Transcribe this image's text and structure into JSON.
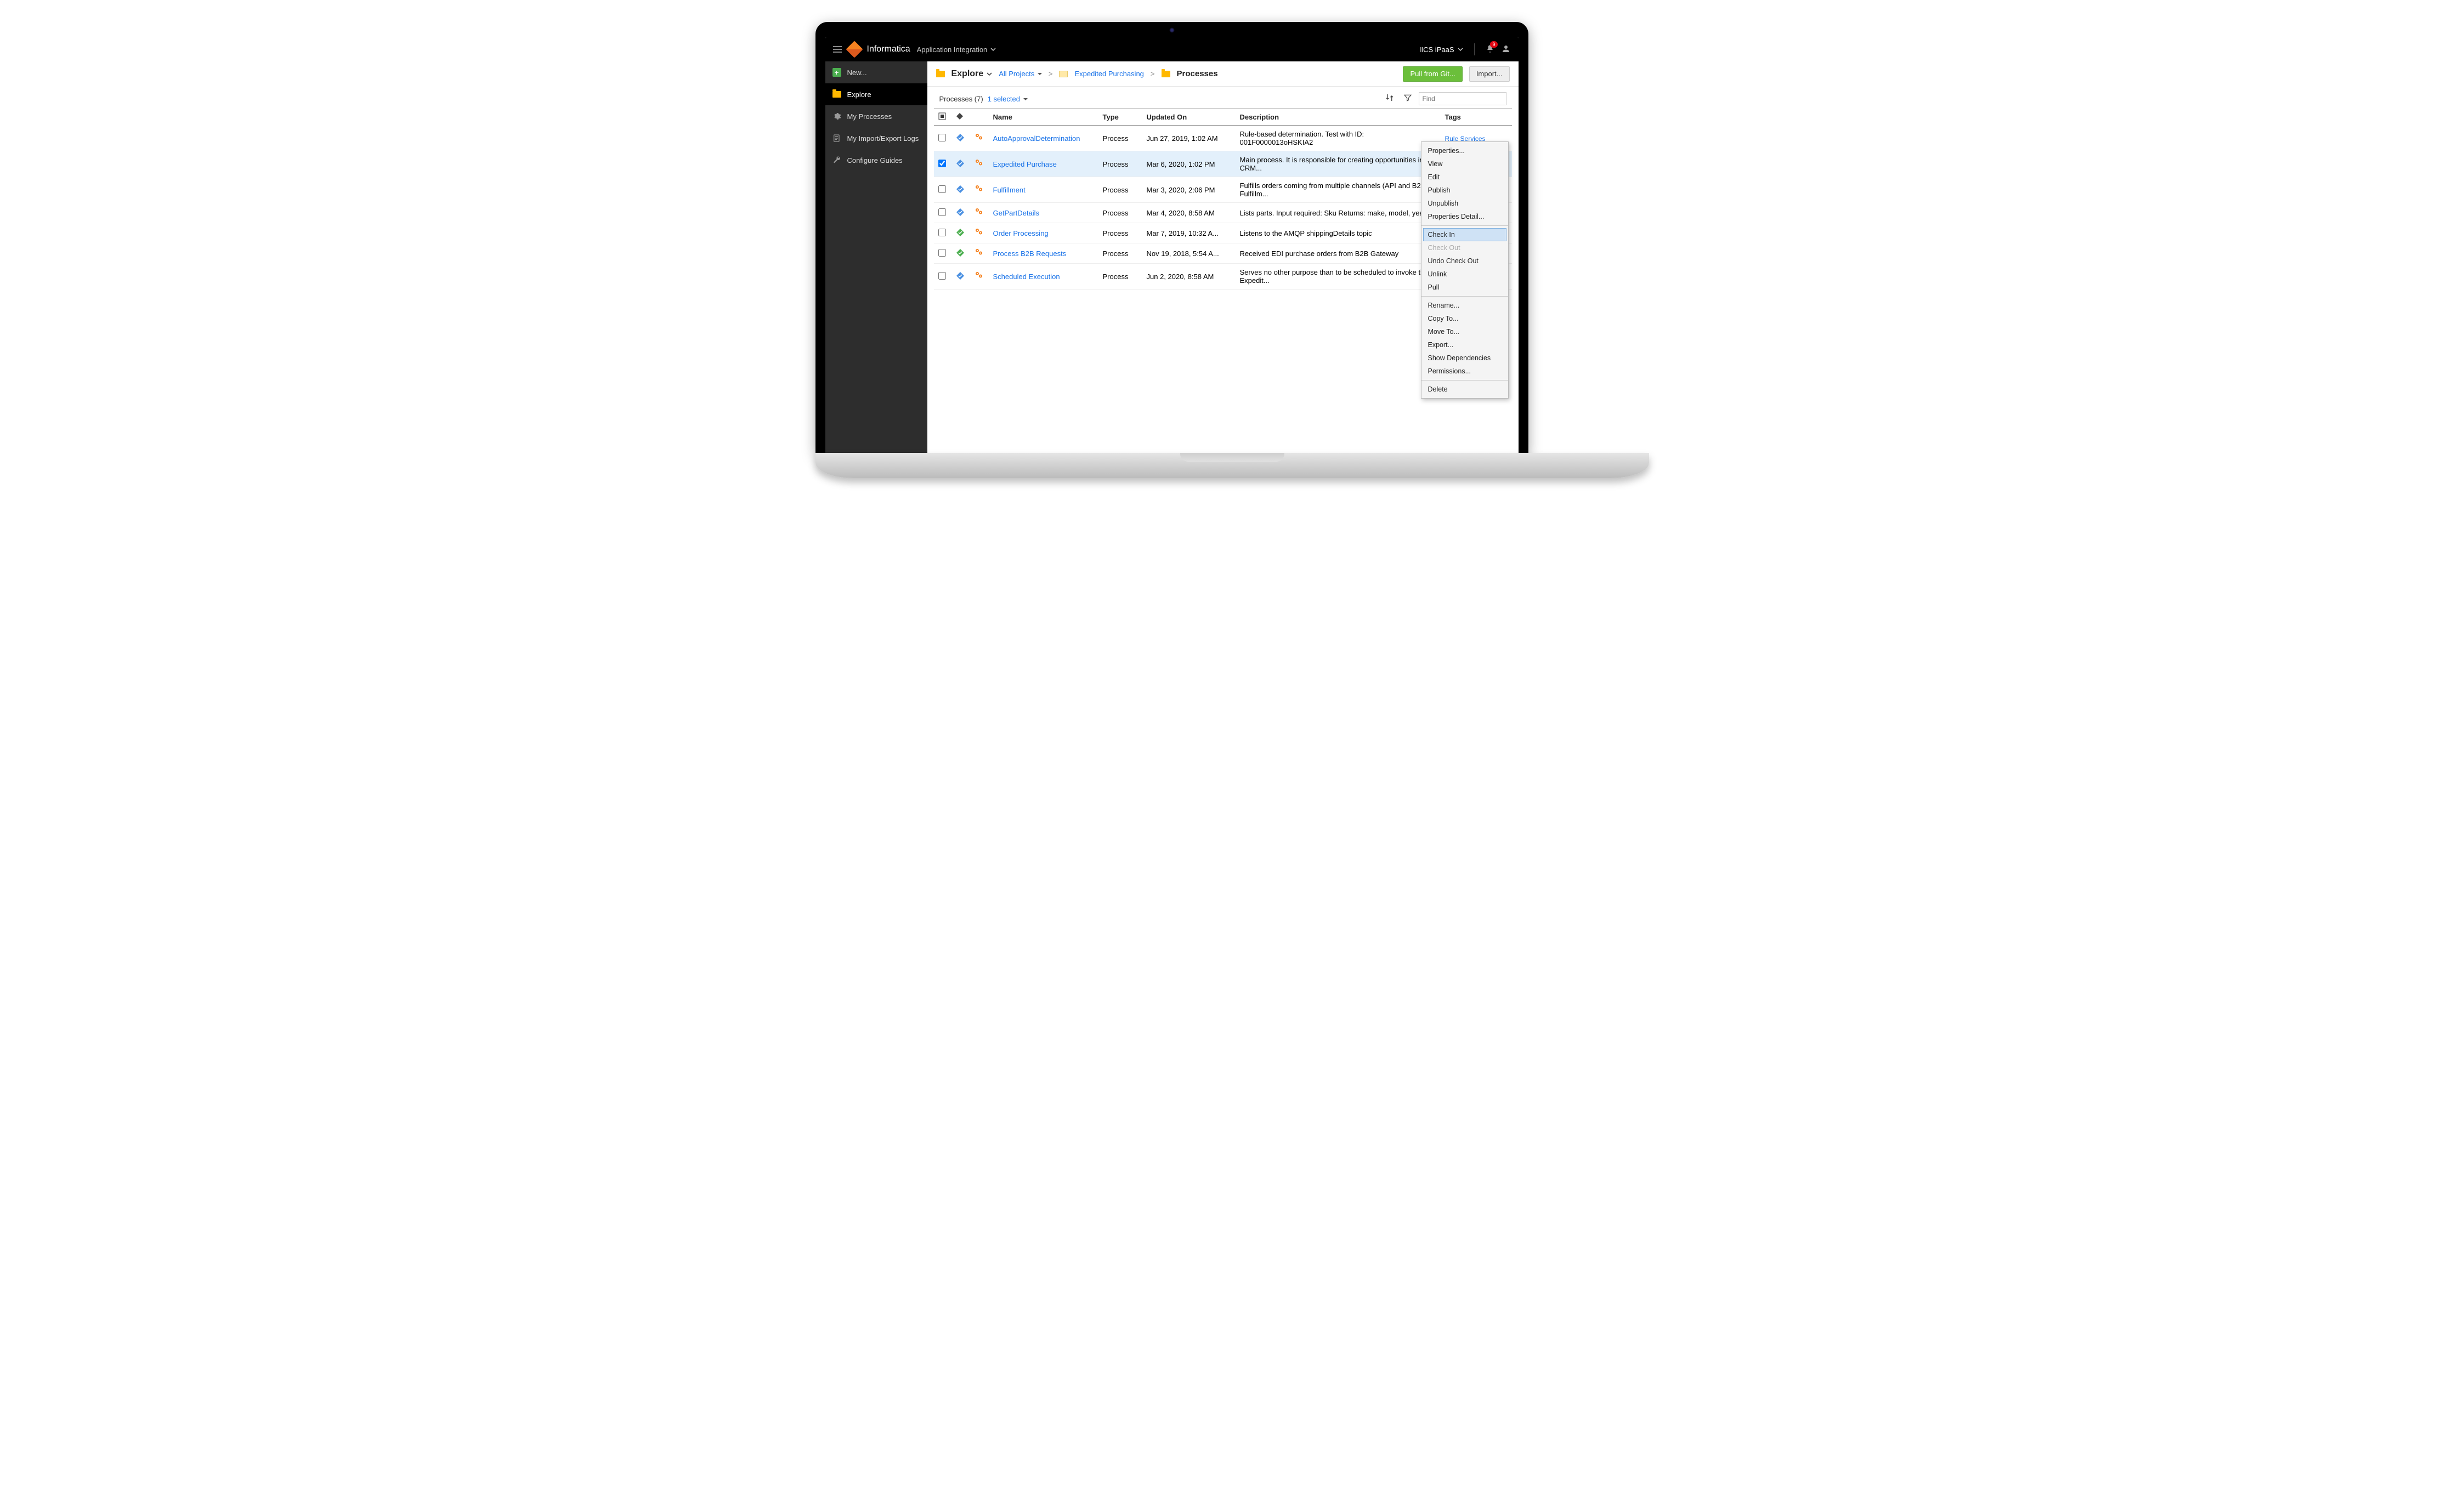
{
  "topbar": {
    "brand": "Informatica",
    "product": "Application Integration",
    "org": "IICS iPaaS",
    "notif_count": "9"
  },
  "sidebar": {
    "items": [
      {
        "label": "New..."
      },
      {
        "label": "Explore"
      },
      {
        "label": "My Processes"
      },
      {
        "label": "My Import/Export Logs"
      },
      {
        "label": "Configure Guides"
      }
    ]
  },
  "breadcrumb": {
    "root": "Explore",
    "allprojects": "All Projects",
    "project": "Expedited Purchasing",
    "folder": "Processes",
    "pull_btn": "Pull from Git...",
    "import_btn": "Import..."
  },
  "list": {
    "title": "Processes (7)",
    "selected": "1 selected",
    "find_placeholder": "Find",
    "columns": {
      "name": "Name",
      "type": "Type",
      "updated": "Updated On",
      "description": "Description",
      "tags": "Tags"
    },
    "rows": [
      {
        "checked": false,
        "status": "sync",
        "name": "AutoApprovalDetermination",
        "type": "Process",
        "updated": "Jun 27, 2019, 1:02 AM",
        "desc": "Rule-based determination. Test with ID: 001F0000013oHSKIA2",
        "tags": "Rule Services"
      },
      {
        "checked": true,
        "status": "sync",
        "name": "Expedited Purchase",
        "type": "Process",
        "updated": "Mar 6, 2020, 1:02 PM",
        "desc": "Main process. It is responsible for creating opportunities in the CRM...",
        "tags": ""
      },
      {
        "checked": false,
        "status": "sync",
        "name": "Fulfillment",
        "type": "Process",
        "updated": "Mar 3, 2020, 2:06 PM",
        "desc": "Fulfills orders coming from multiple channels (API and B2B). Fulfillm...",
        "tags": ""
      },
      {
        "checked": false,
        "status": "sync",
        "name": "GetPartDetails",
        "type": "Process",
        "updated": "Mar 4, 2020, 8:58 AM",
        "desc": "Lists parts. Input required: Sku Returns: make, model, year ...",
        "tags": ""
      },
      {
        "checked": false,
        "status": "ok",
        "name": "Order Processing",
        "type": "Process",
        "updated": "Mar 7, 2019, 10:32 A...",
        "desc": "Listens to the AMQP shippingDetails topic",
        "tags": ""
      },
      {
        "checked": false,
        "status": "ok",
        "name": "Process B2B Requests",
        "type": "Process",
        "updated": "Nov 19, 2018, 5:54 A...",
        "desc": "Received EDI purchase orders from B2B Gateway",
        "tags": ""
      },
      {
        "checked": false,
        "status": "sync",
        "name": "Scheduled Execution",
        "type": "Process",
        "updated": "Jun 2, 2020, 8:58 AM",
        "desc": "Serves no other purpose than to be scheduled to invoke the Expedit...",
        "tags": ""
      }
    ]
  },
  "context_menu": {
    "section1": [
      "Properties...",
      "View",
      "Edit",
      "Publish",
      "Unpublish",
      "Properties Detail..."
    ],
    "section2": [
      "Check In",
      "Check Out",
      "Undo Check Out",
      "Unlink",
      "Pull"
    ],
    "section2_highlight_index": 0,
    "section2_disabled_index": 1,
    "section3": [
      "Rename...",
      "Copy To...",
      "Move To...",
      "Export...",
      "Show Dependencies",
      "Permissions..."
    ],
    "section4": [
      "Delete"
    ]
  }
}
